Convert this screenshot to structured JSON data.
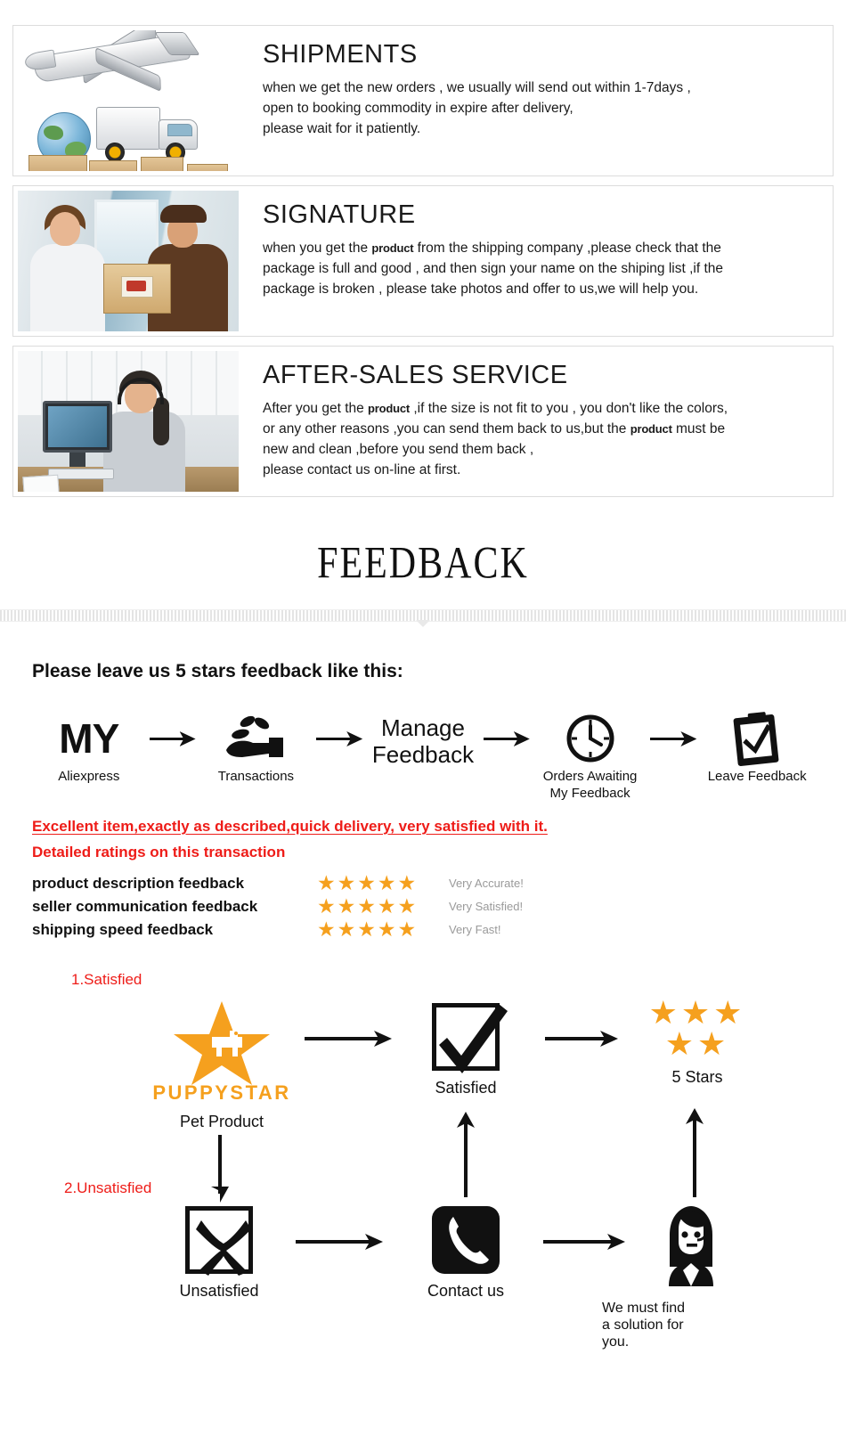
{
  "panels": [
    {
      "id": "shipments",
      "title": "SHIPMENTS",
      "image_name": "air-freight-truck-illustration",
      "lines": [
        "when we get the new orders , we usually will send out within 1-7days ,",
        "open to booking commodity in expire after delivery,",
        "please wait for it patiently."
      ]
    },
    {
      "id": "signature",
      "title": "SIGNATURE",
      "image_name": "courier-handing-parcel-photo",
      "lines": [
        "when you get the product from the shipping company ,please check that the",
        "package is full and good , and then sign your name on the shiping list ,if the",
        "package is broken , please take photos and offer to us,we will help you."
      ]
    },
    {
      "id": "after-sales",
      "title": "AFTER-SALES SERVICE",
      "image_name": "call-centre-agent-photo",
      "lines": [
        "After you get the product ,if the size is not fit to you , you don't like the colors,",
        "or any other reasons ,you can send them back to us,but the product must be",
        "new and clean ,before you send them back ,",
        "please contact us on-line at first."
      ]
    }
  ],
  "feedback": {
    "heading": "FEEDBACK",
    "lead": "Please leave us 5 stars feedback like this:",
    "steps": [
      {
        "icon": "my-aliexpress-icon",
        "big": "MY",
        "label": "Aliexpress"
      },
      {
        "icon": "hand-coins-icon",
        "big": "",
        "label": "Transactions"
      },
      {
        "icon": "manage-feedback-text-icon",
        "big": "",
        "label": "Manage\nFeedback"
      },
      {
        "icon": "clock-icon",
        "big": "",
        "label": "Orders Awaiting\nMy Feedback"
      },
      {
        "icon": "clipboard-check-icon",
        "big": "",
        "label": "Leave Feedback"
      }
    ],
    "review": {
      "comment": "Excellent item,exactly as described,quick delivery, very satisfied with it.",
      "detail_heading": "Detailed ratings on this transaction",
      "ratings": [
        {
          "name": "product description feedback",
          "stars": "★★★★★",
          "tag": "Very Accurate!"
        },
        {
          "name": "seller communication feedback",
          "stars": "★★★★★",
          "tag": "Very Satisfied!"
        },
        {
          "name": "shipping speed feedback",
          "stars": "★★★★★",
          "tag": "Very Fast!"
        }
      ]
    },
    "flow": {
      "tag_satisfied": "1.Satisfied",
      "tag_unsatisfied": "2.Unsatisfied",
      "brand_word": "PUPPYSTAR",
      "brand_caption": "Pet  Product",
      "satisfied_caption": "Satisfied",
      "stars_caption": "5 Stars",
      "stars_top": "★★★",
      "stars_bottom": "★★",
      "unsatisfied_caption": "Unsatisfied",
      "contact_caption": "Contact us",
      "agent_caption_line1": "We must find",
      "agent_caption_line2": "a solution for",
      "agent_caption_line3": "you."
    }
  },
  "colors": {
    "star_orange": "#F5A01E",
    "brand_orange": "#F5A01E",
    "alert_red": "#ee1c18",
    "ink": "#111111",
    "muted": "#9a9a9a",
    "panel_border": "#dcdcdc"
  }
}
